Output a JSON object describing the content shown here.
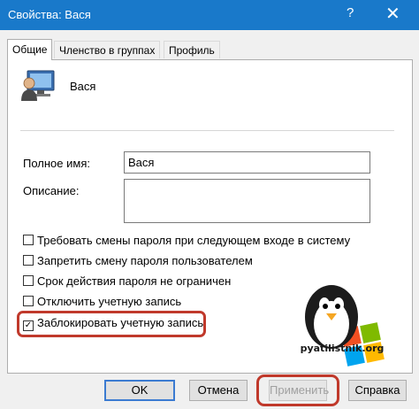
{
  "window": {
    "title": "Свойства: Вася",
    "help_glyph": "?",
    "close_glyph": "✕"
  },
  "tabs": [
    {
      "label": "Общие",
      "active": true
    },
    {
      "label": "Членство в группах",
      "active": false
    },
    {
      "label": "Профиль",
      "active": false
    }
  ],
  "user": {
    "name": "Вася"
  },
  "fields": {
    "full_name_label": "Полное имя:",
    "full_name_value": "Вася",
    "description_label": "Описание:",
    "description_value": ""
  },
  "checkboxes": [
    {
      "label": "Требовать смены пароля при следующем входе в систему",
      "checked": false
    },
    {
      "label": "Запретить смену пароля пользователем",
      "checked": false
    },
    {
      "label": "Срок действия пароля не ограничен",
      "checked": false
    },
    {
      "label": "Отключить учетную запись",
      "checked": false
    },
    {
      "label": "Заблокировать учетную запись",
      "checked": true
    }
  ],
  "watermark": {
    "text": "pyatilistnik.org"
  },
  "buttons": {
    "ok": "OK",
    "cancel": "Отмена",
    "apply": "Применить",
    "help": "Справка"
  },
  "colors": {
    "titlebar": "#1979ca",
    "highlight": "#c0392b",
    "default_button_border": "#3b7bd1"
  }
}
